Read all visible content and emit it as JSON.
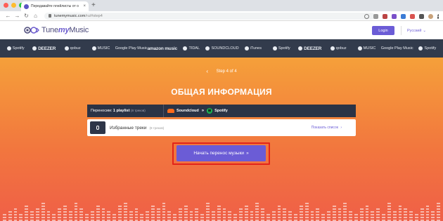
{
  "browser": {
    "tab_title": "Передавайте плейлисты от о",
    "tab_close": "×",
    "new_tab": "+",
    "url_host": "tunemymusic.com",
    "url_path": "/ru/#step4",
    "nav_back": "←",
    "nav_forward": "→",
    "nav_reload": "↻",
    "nav_home": "⌂",
    "light_colors": [
      "#ff5f57",
      "#febc2e",
      "#28c840"
    ]
  },
  "header": {
    "logo_main": "Tune",
    "logo_my": "my",
    "logo_end": "Music",
    "login_label": "Login",
    "language": "Русский",
    "language_chevron": "⌄"
  },
  "services": [
    {
      "label": "Spotify",
      "icon": "spotify-icon",
      "bold": false
    },
    {
      "label": "DEEZER",
      "icon": "deezer-icon",
      "bold": true
    },
    {
      "label": "qobuz",
      "icon": "qobuz-icon",
      "bold": false
    },
    {
      "label": "MUSIC",
      "icon": "apple-icon",
      "bold": false
    },
    {
      "label": "Google Play Music",
      "icon": "",
      "bold": false
    },
    {
      "label": "amazon music",
      "icon": "",
      "bold": true
    },
    {
      "label": "TIDAL",
      "icon": "tidal-icon",
      "bold": false
    },
    {
      "label": "SOUNDCLOUD",
      "icon": "soundcloud-icon",
      "bold": false
    },
    {
      "label": "iTunes",
      "icon": "apple-icon",
      "bold": false
    },
    {
      "label": "Spotify",
      "icon": "spotify-icon",
      "bold": false
    },
    {
      "label": "DEEZER",
      "icon": "deezer-icon",
      "bold": true
    },
    {
      "label": "qobuz",
      "icon": "qobuz-icon",
      "bold": false
    },
    {
      "label": "MUSIC",
      "icon": "apple-icon",
      "bold": false
    },
    {
      "label": "Google Play Music",
      "icon": "",
      "bold": false
    },
    {
      "label": "Spotify",
      "icon": "spotify-icon",
      "bold": false
    }
  ],
  "hero": {
    "step_back": "‹",
    "step_text": "Step 4 of 4",
    "title": "ОБЩАЯ ИНФОРМАЦИЯ",
    "transfer_prefix": "Переносим:",
    "transfer_count": "1 playlist",
    "transfer_tracks": "(8 треков)",
    "source": "Soundcloud",
    "arrow": "»",
    "target": "Spotify",
    "playlist_name": "Избранные треки",
    "playlist_tracks": "(8 треков)",
    "show_list": "Показать список",
    "show_list_chevron": "›",
    "start_label": "Начать перенос музыки",
    "start_arrow": "»"
  },
  "colors": {
    "accent": "#6b5cd6",
    "strip": "#323b4c",
    "highlight": "#e3241a"
  }
}
